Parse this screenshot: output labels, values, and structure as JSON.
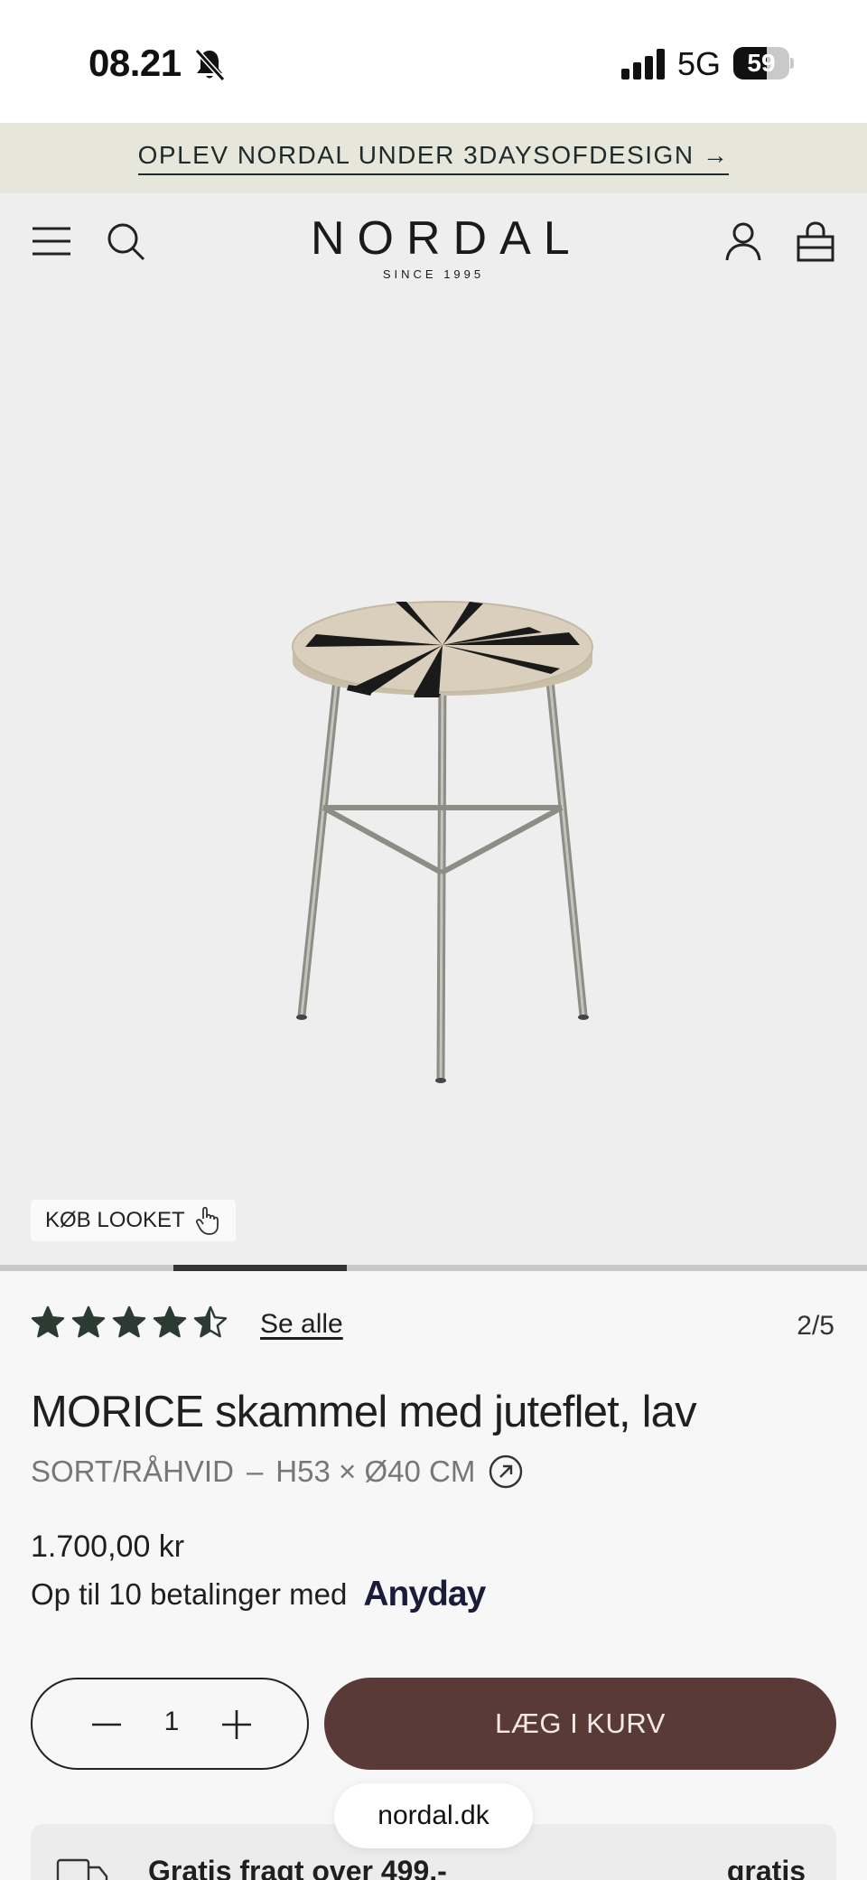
{
  "status_bar": {
    "time": "08.21",
    "network": "5G",
    "battery": "59",
    "battery_level": 0.59
  },
  "promo": {
    "text": "OPLEV NORDAL UNDER 3DAYSOFDESIGN →"
  },
  "header": {
    "logo": "NORDAL",
    "logo_tagline": "SINCE 1995",
    "icons": [
      "menu-icon",
      "search-icon",
      "account-icon",
      "cart-icon"
    ]
  },
  "gallery": {
    "look_button": "KØB LOOKET",
    "current_slide": 2,
    "total_slides": 5
  },
  "product": {
    "rating": 4.5,
    "reviews_link": "Se alle",
    "slide_counter": "2/5",
    "title": "MORICE skammel med juteflet, lav",
    "color": "SORT/RÅHVID",
    "dimensions": "H53 × Ø40 CM",
    "price": "1.700,00 kr",
    "installments_text": "Op til 10 betalinger med",
    "installments_provider": "Anyday",
    "quantity": "1",
    "add_to_cart": "LÆG I KURV"
  },
  "shipping": {
    "text": "Gratis fragt over 499,-",
    "value": "gratis"
  },
  "browser": {
    "url": "nordal.dk"
  },
  "colors": {
    "accent": "#5a3a36",
    "star": "#2c3a34",
    "promo_bg": "#e7e6da"
  }
}
